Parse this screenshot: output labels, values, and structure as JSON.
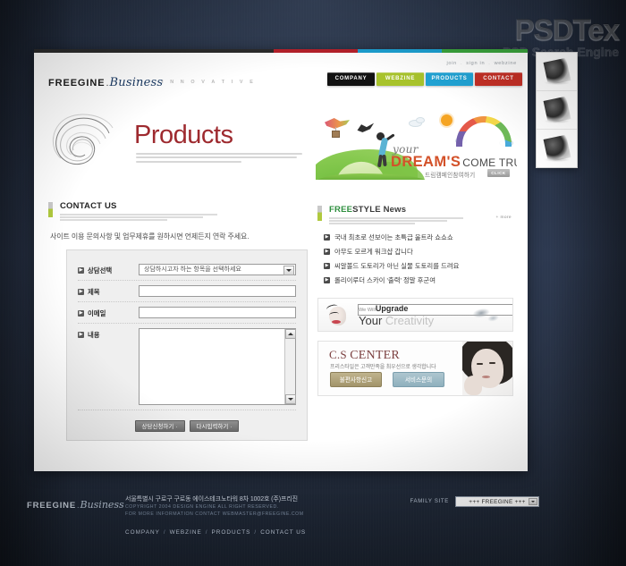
{
  "watermark": {
    "main": "PSDTex",
    "sub": "PSD Search Engine"
  },
  "header": {
    "logo_main": "FREEGINE",
    "logo_dot": ".",
    "logo_script": "Business",
    "tagline": "I N N O V A T I V E",
    "util_links": [
      "join",
      "sign in",
      "webzine"
    ],
    "util_sep": ".",
    "nav": [
      {
        "label": "COMPANY",
        "color": "#121212"
      },
      {
        "label": "WEBZINE",
        "color": "#a8c32c"
      },
      {
        "label": "PRODUCTS",
        "color": "#21a3d4"
      },
      {
        "label": "CONTACT",
        "color": "#c43026"
      }
    ]
  },
  "hero": {
    "page_title": "Products",
    "banner": {
      "script_word": "your",
      "headline_bold": "DREAM'S",
      "headline_rest": "COME TRUE",
      "korean_line": "드림캠페인참여하기",
      "click_button": "CLICK"
    }
  },
  "contact_section": {
    "heading": "CONTACT US",
    "intro": "사이트 이용 문의사항 및 업무제휴를 원하시면 언제든지 연락 주세요.",
    "fields": [
      {
        "label": "상담선택",
        "type": "select",
        "value": "상담하시고자 하는 항목을 선택하세요"
      },
      {
        "label": "제목",
        "type": "text",
        "value": ""
      },
      {
        "label": "이메일",
        "type": "text",
        "value": ""
      },
      {
        "label": "내용",
        "type": "textarea",
        "value": ""
      }
    ],
    "bullet": "▶",
    "buttons": [
      {
        "label": "상담신청하기 ·"
      },
      {
        "label": "다시입력하기 ·"
      }
    ]
  },
  "news_section": {
    "heading_green": "FREE",
    "heading_dark": "STYLE News",
    "more_label": "+ more",
    "bullet": "▶",
    "items": [
      "국내 최초로 선보이는 초특급 울트라 쇼쇼쇼",
      "아무도 모르게 워크샵 갑니다",
      "씨알볼드 도토리가 아닌 실물 도토리를 드려요",
      "롤리이루더 스카이 '출력' 정말 후군여"
    ]
  },
  "promo_banner": {
    "small_line": "We Will",
    "bold_line": "Upgrade",
    "second_line": "Your",
    "second_line_dim": "Creativity"
  },
  "cs_center": {
    "title_small": "C.S",
    "title_big": "CENTER",
    "subtitle": "프리스타일은 고객만족을 최우선으로 생각합니다",
    "buttons": [
      {
        "label": "불편사항신고",
        "style": "beige"
      },
      {
        "label": "서비스문의",
        "style": "blue"
      }
    ]
  },
  "thumbs_panel": {
    "items": [
      "product-thumb-1",
      "product-thumb-2",
      "product-thumb-3"
    ]
  },
  "footer": {
    "logo_main": "FREEGINE",
    "logo_dot": ".",
    "logo_script": "Business",
    "address": "서울특별시 구로구 구로동 에이스테크노타워 8차 1002호 (주)프리진",
    "copyright_line1": "COPYRIGHT 2004  DESIGN ENGINE ALL RIGHT RESERVED.",
    "copyright_line2": "FOR MORE INFORMATION CONTACT WEBMASTER@FREEGINE.COM",
    "nav": [
      "COMPANY",
      "WEBZINE",
      "PRODUCTS",
      "CONTACT US"
    ],
    "nav_sep": "/",
    "family_site_label": "FAMILY SITE",
    "family_site_value": "+++ FREEGINE +++"
  }
}
